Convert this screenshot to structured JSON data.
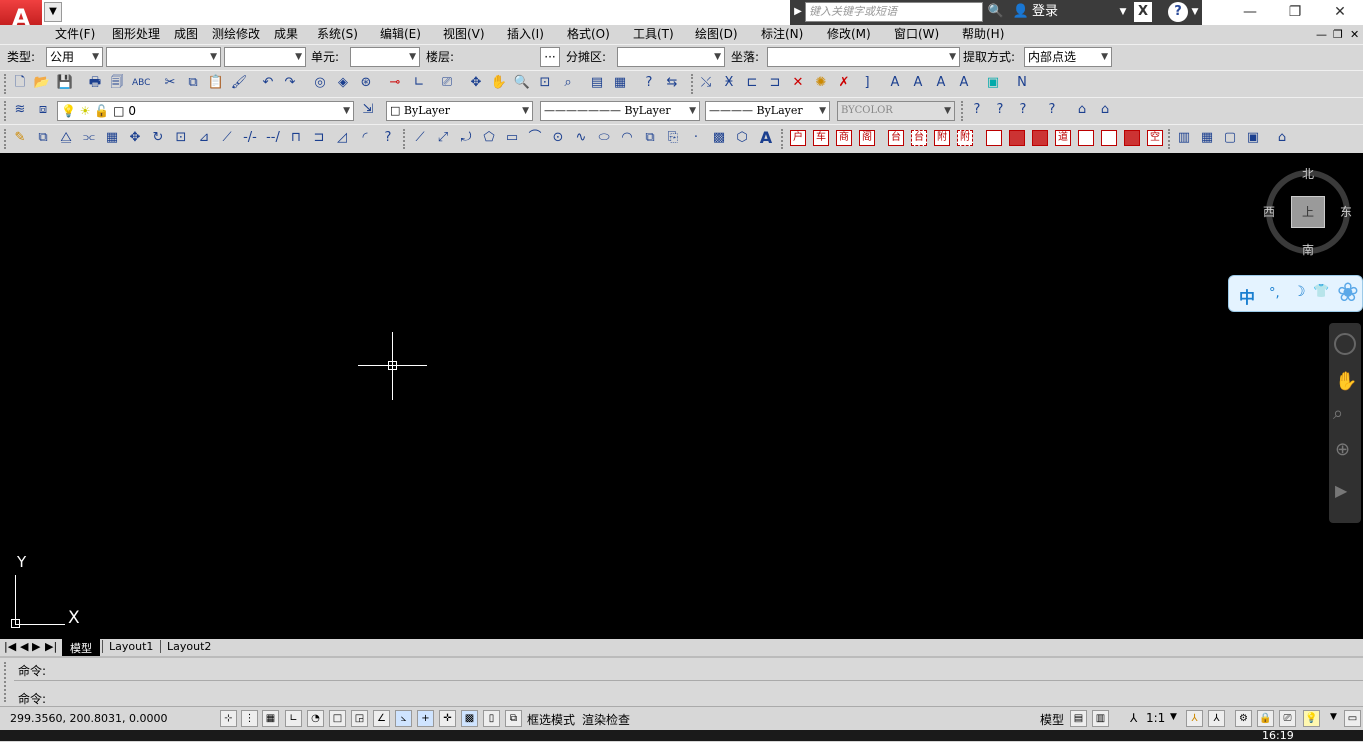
{
  "titlebar": {
    "search_placeholder": "键入关键字或短语",
    "login_label": "登录",
    "help": "?",
    "min": "—",
    "restore": "❐",
    "close": "✕"
  },
  "menu": [
    "文件(F)",
    "图形处理",
    "成图",
    "测绘修改",
    "成果",
    "系统(S)",
    "编辑(E)",
    "视图(V)",
    "插入(I)",
    "格式(O)",
    "工具(T)",
    "绘图(D)",
    "标注(N)",
    "修改(M)",
    "窗口(W)",
    "帮助(H)"
  ],
  "toolbar1": {
    "type_label": "类型:",
    "type_value": "公用",
    "unit_label": "单元:",
    "floor_label": "楼层:",
    "ellipsis": "···",
    "zone_label": "分摊区:",
    "seat_label": "坐落:",
    "extract_label": "提取方式:",
    "extract_value": "内部点选"
  },
  "layer_toolbar": {
    "layer_name": "0",
    "color": "ByLayer",
    "linetype": "ByLayer",
    "lineweight": "ByLayer",
    "plotstyle": "BYCOLOR"
  },
  "red_icons": [
    "户",
    "车",
    "商",
    "阁",
    "台",
    "台",
    "附",
    "附",
    "",
    "",
    "",
    "道",
    "",
    "",
    "",
    "空"
  ],
  "viewcube": {
    "north": "北",
    "south": "南",
    "east": "东",
    "west": "西",
    "top": "上"
  },
  "ime_bar": {
    "lang": "中",
    "punct": "°,",
    "moon": "☽",
    "shirt": "👕"
  },
  "ucs": {
    "y": "Y",
    "x": "X"
  },
  "layout_tabs": [
    "模型",
    "Layout1",
    "Layout2"
  ],
  "command": {
    "line1": "命令:",
    "line2": "命令:"
  },
  "status": {
    "coords": "299.3560, 200.8031, 0.0000",
    "frame_mode": "框选模式",
    "render_check": "渲染检查",
    "model_label": "模型",
    "scale": "1:1"
  },
  "taskbar": {
    "time": "16:19"
  },
  "colors": {
    "canvas": "#000000",
    "chrome": "#d7d7d7",
    "titlebar_dark": "#3b3b3b",
    "accent_red": "#c8102e"
  }
}
